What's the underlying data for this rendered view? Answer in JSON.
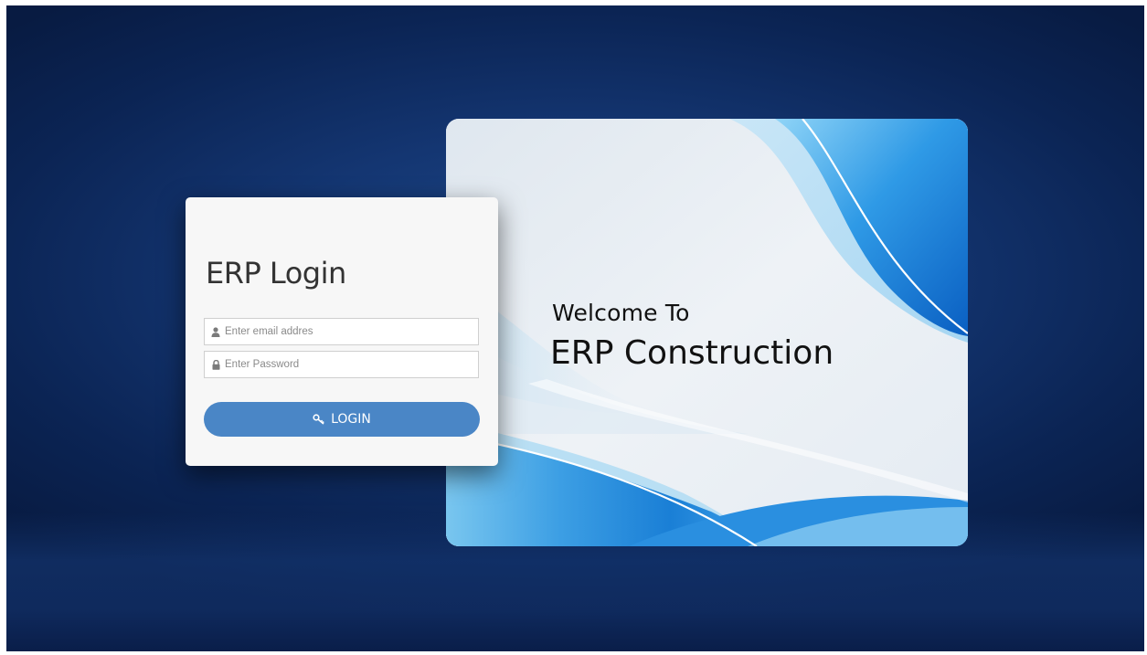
{
  "welcome": {
    "line1": "Welcome To",
    "line2": "ERP Construction"
  },
  "login": {
    "title": "ERP Login",
    "email_placeholder": "Enter email addres",
    "email_value": "",
    "password_placeholder": "Enter Password",
    "password_value": "",
    "button_label": "LOGIN"
  },
  "icons": {
    "email": "user-icon",
    "password": "lock-icon",
    "button": "key-icon"
  },
  "colors": {
    "background": "#143672",
    "button": "#4a86c6",
    "card": "#f7f7f7",
    "accent_wave": "#1a7fd6"
  }
}
